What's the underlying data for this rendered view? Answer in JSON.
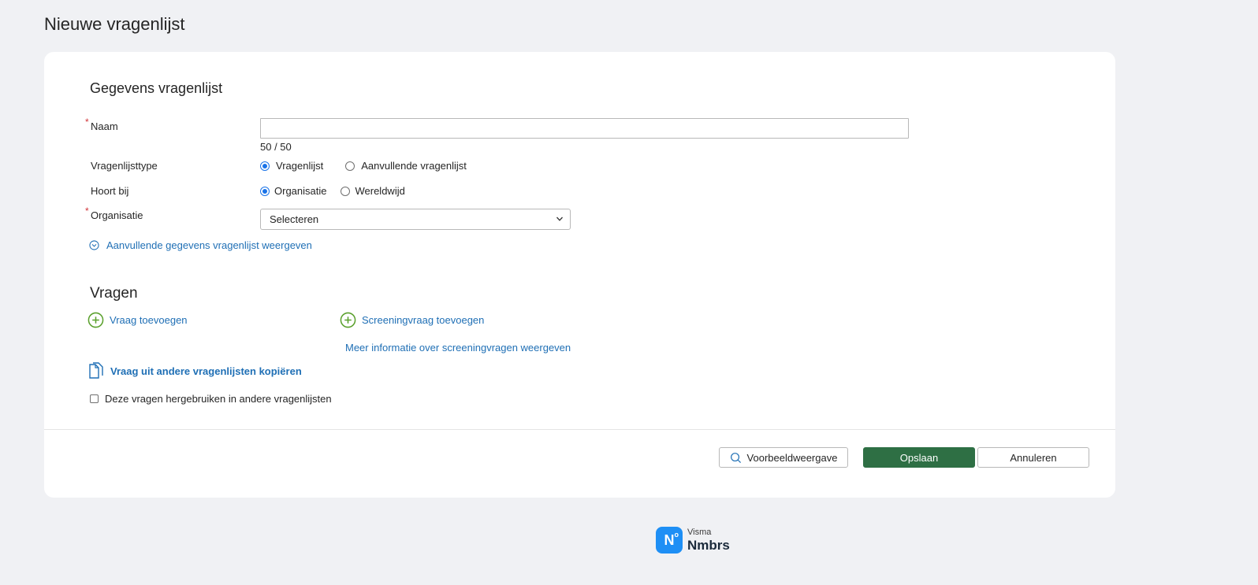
{
  "page": {
    "title": "Nieuwe vragenlijst"
  },
  "details": {
    "section_title": "Gegevens vragenlijst",
    "required_marker": "*",
    "name_label": "Naam",
    "name_value": "",
    "name_counter": "50 / 50",
    "type_label": "Vragenlijsttype",
    "type_options": [
      "Vragenlijst",
      "Aanvullende vragenlijst"
    ],
    "type_selected": "Vragenlijst",
    "belongs_label": "Hoort bij",
    "belongs_options": [
      "Organisatie",
      "Wereldwijd"
    ],
    "belongs_selected": "Organisatie",
    "org_label": "Organisatie",
    "org_value": "Selecteren",
    "expand_link": "Aanvullende gegevens vragenlijst weergeven"
  },
  "questions": {
    "section_title": "Vragen",
    "add_question": "Vraag toevoegen",
    "add_screening": "Screeningvraag toevoegen",
    "screening_info": "Meer informatie over screeningvragen weergeven",
    "copy_link": "Vraag uit andere vragenlijsten kopiëren",
    "reuse_checkbox": "Deze vragen hergebruiken in andere vragenlijsten",
    "reuse_checked": false
  },
  "actions": {
    "preview": "Voorbeeldweergave",
    "save": "Opslaan",
    "cancel": "Annuleren"
  },
  "footer": {
    "logo_mark": "N",
    "logo_sup": "o",
    "brand_small": "Visma",
    "brand_big": "Nmbrs"
  },
  "colors": {
    "accent_link": "#1f6fb5",
    "add_icon": "#5aa02c",
    "save_button": "#2e6f44",
    "required": "#d13438",
    "logo": "#1e8ff5"
  }
}
